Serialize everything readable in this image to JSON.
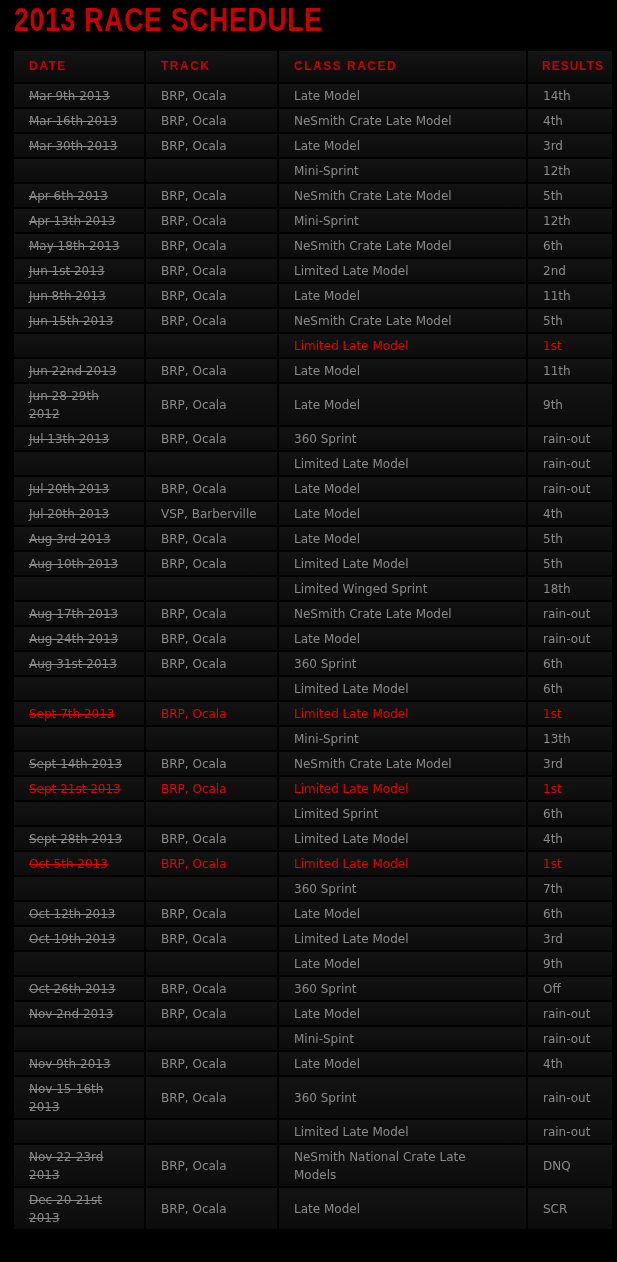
{
  "title": "2013 RACE SCHEDULE",
  "table": {
    "columns": [
      "DATE",
      "TRACK",
      "CLASS RACED",
      "RESULTS"
    ],
    "rows": [
      {
        "date": "Mar 9th 2013",
        "struck": true,
        "track": "BRP, Ocala",
        "class": "Late Model",
        "result": "14th",
        "highlighted": false
      },
      {
        "date": "Mar 16th 2013",
        "struck": true,
        "track": "BRP, Ocala",
        "class": "NeSmith Crate Late Model",
        "result": "4th",
        "highlighted": false
      },
      {
        "date": "Mar 30th 2013",
        "struck": true,
        "track": "BRP, Ocala",
        "class": "Late Model",
        "result": "3rd",
        "highlighted": false
      },
      {
        "class": "Mini-Sprint",
        "result": "12th",
        "highlighted": false
      },
      {
        "date": "Apr 6th 2013",
        "struck": true,
        "track": "BRP, Ocala",
        "class": "NeSmith Crate Late Model",
        "result": "5th",
        "highlighted": false
      },
      {
        "date": "Apr 13th 2013",
        "struck": true,
        "track": "BRP, Ocala",
        "class": "Mini-Sprint",
        "result": "12th",
        "highlighted": false
      },
      {
        "date": "May 18th 2013",
        "struck": true,
        "track": "BRP, Ocala",
        "class": "NeSmith Crate Late Model",
        "result": "6th",
        "highlighted": false
      },
      {
        "date": "Jun 1st 2013",
        "struck": true,
        "track": "BRP, Ocala",
        "class": "Limited Late Model",
        "result": "2nd",
        "highlighted": false
      },
      {
        "date": "Jun 8th 2013",
        "struck": true,
        "track": "BRP, Ocala",
        "class": "Late Model",
        "result": "11th",
        "highlighted": false
      },
      {
        "date": "Jun 15th 2013",
        "struck": true,
        "track": "BRP, Ocala",
        "class": "NeSmith Crate Late Model",
        "result": "5th",
        "highlighted": false
      },
      {
        "class": "Limited Late Model",
        "result": "1st",
        "highlighted": true
      },
      {
        "date": "Jun 22nd 2013",
        "struck": true,
        "track": "BRP, Ocala",
        "class": "Late Model",
        "result": "11th",
        "highlighted": false
      },
      {
        "date": "Jun 28-29th 2012",
        "struck": true,
        "track": "BRP, Ocala",
        "class": "Late Model",
        "result": "9th",
        "highlighted": false
      },
      {
        "date": "Jul 13th 2013",
        "struck": true,
        "track": "BRP, Ocala",
        "class": "360 Sprint",
        "result": "rain-out",
        "highlighted": false
      },
      {
        "class": "Limited Late Model",
        "result": "rain-out",
        "highlighted": false
      },
      {
        "date": "Jul 20th 2013",
        "struck": true,
        "track": "BRP, Ocala",
        "class": "Late Model",
        "result": "rain-out",
        "highlighted": false
      },
      {
        "date": "Jul 20th 2013",
        "struck": true,
        "track": "VSP, Barberville",
        "class": "Late Model",
        "result": "4th",
        "highlighted": false
      },
      {
        "date": "Aug 3rd 2013",
        "struck": true,
        "track": "BRP, Ocala",
        "class": "Late Model",
        "result": "5th",
        "highlighted": false
      },
      {
        "date": "Aug 10th 2013",
        "struck": true,
        "track": "BRP, Ocala",
        "class": "Limited Late Model",
        "result": "5th",
        "highlighted": false
      },
      {
        "class": "Limited Winged Sprint",
        "result": "18th",
        "highlighted": false
      },
      {
        "date": "Aug 17th 2013",
        "struck": true,
        "track": "BRP, Ocala",
        "class": "NeSmith Crate Late Model",
        "result": "rain-out",
        "highlighted": false
      },
      {
        "date": "Aug 24th 2013",
        "struck": true,
        "track": "BRP, Ocala",
        "class": "Late Model",
        "result": "rain-out",
        "highlighted": false
      },
      {
        "date": "Aug 31st 2013",
        "struck": true,
        "track": "BRP, Ocala",
        "class": "360 Sprint",
        "result": "6th",
        "highlighted": false
      },
      {
        "class": "Limited Late Model",
        "result": "6th",
        "highlighted": false
      },
      {
        "date": "Sept 7th 2013",
        "struck": true,
        "track": "BRP, Ocala",
        "class": "Limited Late Model",
        "result": "1st",
        "highlighted": true
      },
      {
        "class": "Mini-Sprint",
        "result": "13th",
        "highlighted": false
      },
      {
        "date": "Sept 14th 2013",
        "struck": true,
        "track": "BRP, Ocala",
        "class": "NeSmith Crate Late Model",
        "result": "3rd",
        "highlighted": false
      },
      {
        "date": "Sept 21st 2013",
        "struck": true,
        "track": "BRP, Ocala",
        "class": "Limited Late Model",
        "result": "1st",
        "highlighted": true
      },
      {
        "class": "Limited Sprint",
        "result": "6th",
        "highlighted": false
      },
      {
        "date": "Sept 28th 2013",
        "struck": true,
        "track": "BRP, Ocala",
        "class": "Limited Late Model",
        "result": "4th",
        "highlighted": false
      },
      {
        "date": "Oct 5th 2013",
        "struck": true,
        "track": "BRP, Ocala",
        "class": "Limited Late Model",
        "result": "1st",
        "highlighted": true
      },
      {
        "class": "360 Sprint",
        "result": "7th",
        "highlighted": false
      },
      {
        "date": "Oct 12th 2013",
        "struck": true,
        "track": "BRP, Ocala",
        "class": "Late Model",
        "result": "6th",
        "highlighted": false
      },
      {
        "date": "Oct 19th 2013",
        "struck": true,
        "track": "BRP, Ocala",
        "class": "Limited Late Model",
        "result": "3rd",
        "highlighted": false
      },
      {
        "class": "Late Model",
        "result": "9th",
        "highlighted": false
      },
      {
        "date": "Oct 26th 2013",
        "struck": true,
        "track": "BRP, Ocala",
        "class": "360 Sprint",
        "result": "Off",
        "highlighted": false
      },
      {
        "date": "Nov 2nd 2013",
        "struck": true,
        "track": "BRP, Ocala",
        "class": "Late Model",
        "result": "rain-out",
        "highlighted": false
      },
      {
        "class": "Mini-Spint",
        "result": "rain-out",
        "highlighted": false
      },
      {
        "date": "Nov 9th 2013",
        "struck": true,
        "track": "BRP, Ocala",
        "class": "Late Model",
        "result": "4th",
        "highlighted": false
      },
      {
        "date": "Nov 15-16th 2013",
        "struck": true,
        "track": "BRP, Ocala",
        "class": "360 Sprint",
        "result": "rain-out",
        "highlighted": false
      },
      {
        "class": "Limited Late Model",
        "result": "rain-out",
        "highlighted": false
      },
      {
        "date": "Nov 22-23rd 2013",
        "struck": true,
        "track": "BRP, Ocala",
        "class": "NeSmith National Crate Late Models",
        "result": "DNQ",
        "highlighted": false
      },
      {
        "date": "Dec 20-21st 2013",
        "struck": true,
        "track": "BRP, Ocala",
        "class": "Late Model",
        "result": "SCR",
        "highlighted": false
      }
    ]
  }
}
